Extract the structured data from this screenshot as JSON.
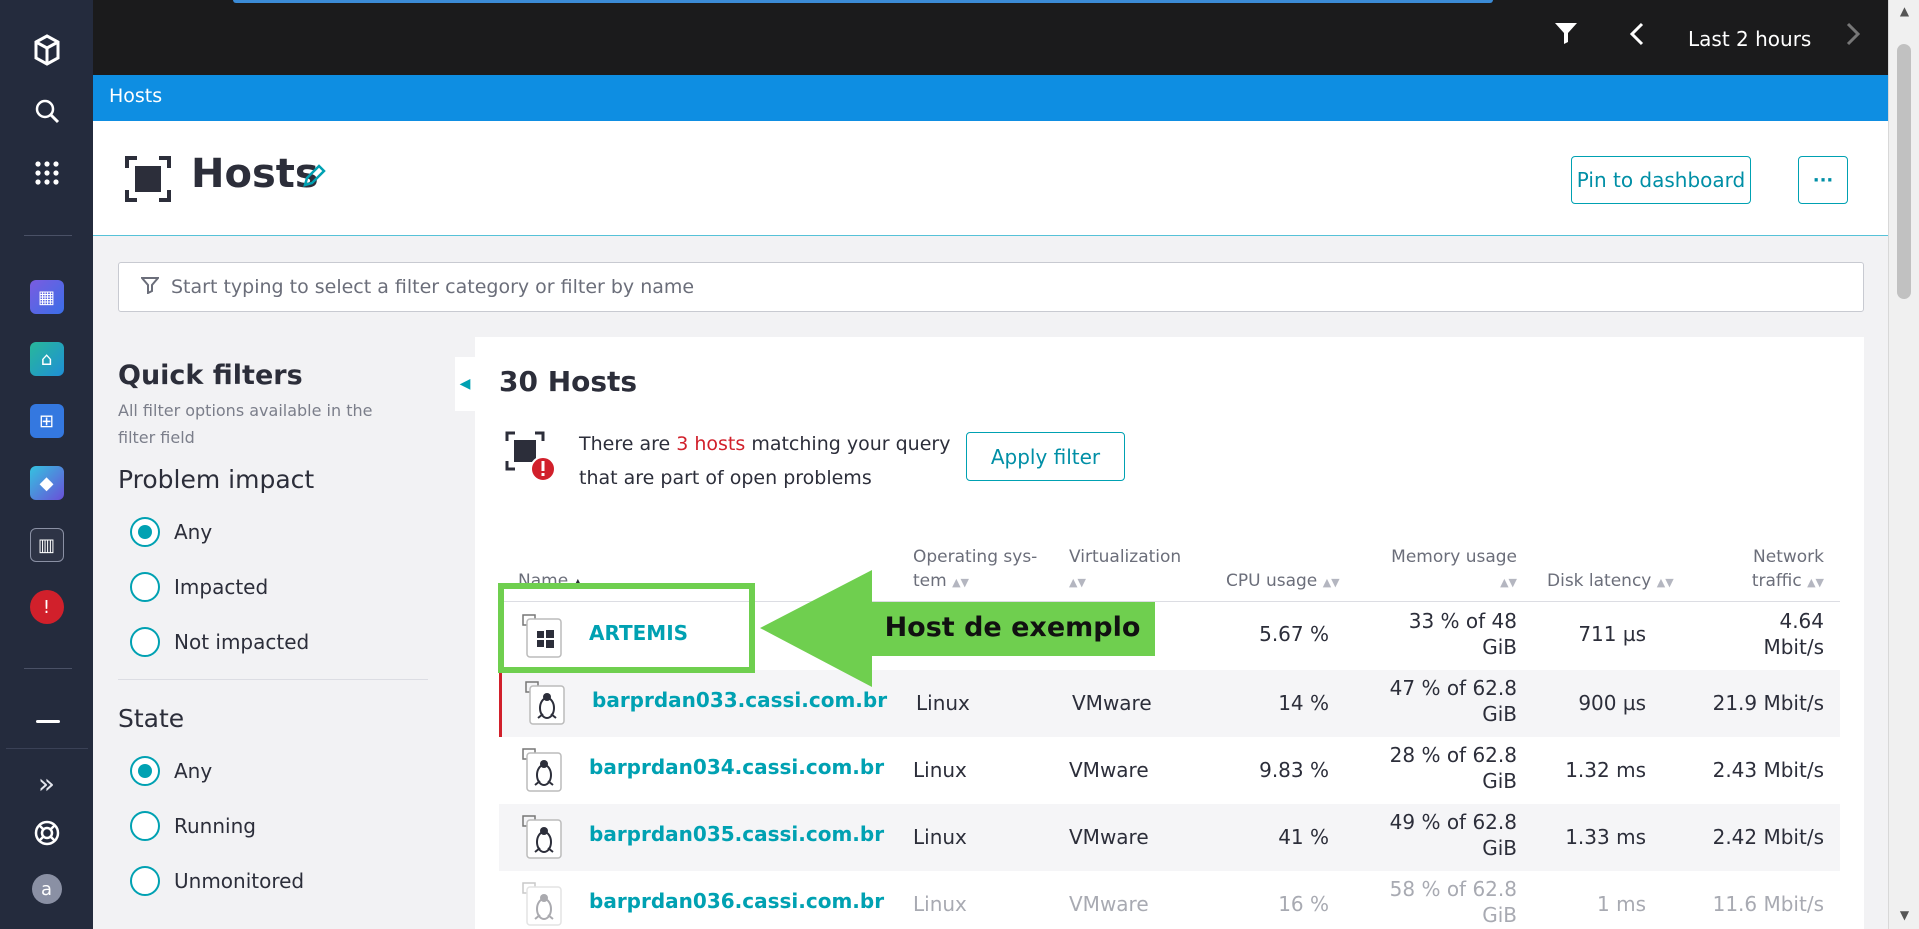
{
  "topbar": {
    "timeframe": "Last 2 hours"
  },
  "breadcrumb": "Hosts",
  "page": {
    "title": "Hosts",
    "pin_label": "Pin to dashboard",
    "more_label": "···"
  },
  "filter": {
    "placeholder": "Start typing to select a filter category or filter by name"
  },
  "quick_filters": {
    "title": "Quick filters",
    "subtitle": "All filter options available in the filter field",
    "problem_impact": {
      "label": "Problem impact",
      "options": [
        "Any",
        "Impacted",
        "Not impacted"
      ],
      "selected": "Any"
    },
    "state": {
      "label": "State",
      "options": [
        "Any",
        "Running",
        "Unmonitored"
      ],
      "selected": "Any"
    }
  },
  "hosts": {
    "count_label": "30 Hosts",
    "problem_prefix": "There are ",
    "problem_count": "3 hosts",
    "problem_mid": " matching your query",
    "problem_suffix": "that are part of open problems",
    "apply_filter_label": "Apply filter"
  },
  "table": {
    "columns": {
      "name": "Name",
      "os_line1": "Operating sys-",
      "os_line2": "tem",
      "virt": "Virtualization",
      "cpu": "CPU usage",
      "mem": "Memory usage",
      "disk": "Disk latency",
      "net_line1": "Network",
      "net_line2": "traffic"
    },
    "rows": [
      {
        "name": "ARTEMIS",
        "os": "",
        "virt": "",
        "cpu": "5.67 %",
        "mem1": "33 % of 48",
        "mem2": "GiB",
        "disk": "711 µs",
        "net1": "4.64",
        "net2": "Mbit/s"
      },
      {
        "name": "barprdan033.cassi.com.br",
        "os": "Linux",
        "virt": "VMware",
        "cpu": "14 %",
        "mem1": "47 % of 62.8",
        "mem2": "GiB",
        "disk": "900 µs",
        "net1": "21.9 Mbit/s",
        "net2": ""
      },
      {
        "name": "barprdan034.cassi.com.br",
        "os": "Linux",
        "virt": "VMware",
        "cpu": "9.83 %",
        "mem1": "28 % of 62.8",
        "mem2": "GiB",
        "disk": "1.32 ms",
        "net1": "2.43 Mbit/s",
        "net2": ""
      },
      {
        "name": "barprdan035.cassi.com.br",
        "os": "Linux",
        "virt": "VMware",
        "cpu": "41 %",
        "mem1": "49 % of 62.8",
        "mem2": "GiB",
        "disk": "1.33 ms",
        "net1": "2.42 Mbit/s",
        "net2": ""
      },
      {
        "name": "barprdan036.cassi.com.br",
        "os": "Linux",
        "virt": "VMware",
        "cpu": "16 %",
        "mem1": "58 % of 62.8",
        "mem2": "GiB",
        "disk": "1 ms",
        "net1": "11.6 Mbit/s",
        "net2": ""
      }
    ]
  },
  "annotation": {
    "label": "Host de exemplo"
  },
  "user": {
    "avatar_letter": "a"
  },
  "colors": {
    "accent": "#00a1b2",
    "brand_blue": "#0e8ee2",
    "nav_bg": "#242b3d",
    "problem_red": "#d1202b",
    "annotation_green": "#6fcf4f"
  }
}
